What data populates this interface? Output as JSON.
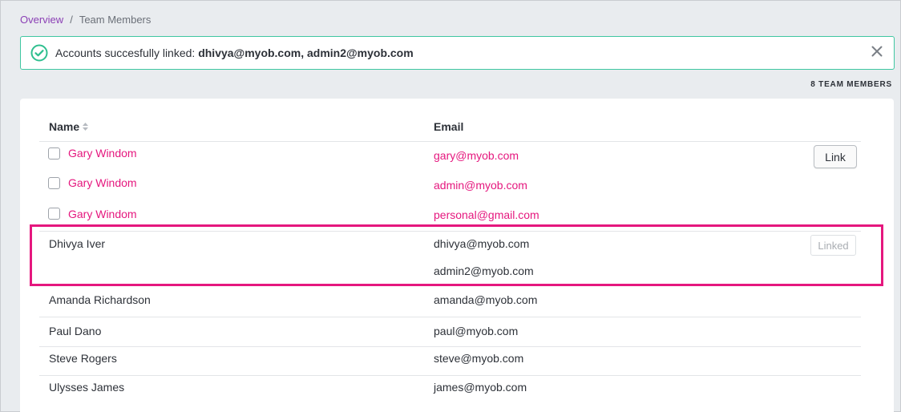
{
  "breadcrumb": {
    "parent": "Overview",
    "separator": "/",
    "current": "Team Members"
  },
  "alert": {
    "message": "Accounts succesfully linked:",
    "emails": "dhivya@myob.com, admin2@myob.com",
    "status_color": "#3fc7a1"
  },
  "member_count": "8 TEAM MEMBERS",
  "table": {
    "headers": {
      "name": "Name",
      "email": "Email"
    },
    "unlinked": [
      {
        "name": "Gary Windom",
        "email": "gary@myob.com"
      },
      {
        "name": "Gary Windom",
        "email": "admin@myob.com"
      },
      {
        "name": "Gary Windom",
        "email": "personal@gmail.com"
      }
    ],
    "link_button": "Link",
    "linked": {
      "name": "Dhivya Iver",
      "emails": [
        "dhivya@myob.com",
        "admin2@myob.com"
      ],
      "status_button": "Linked"
    },
    "members": [
      {
        "name": "Amanda Richardson",
        "email": "amanda@myob.com"
      },
      {
        "name": "Paul Dano",
        "email": "paul@myob.com"
      },
      {
        "name": "Steve Rogers",
        "email": "steve@myob.com"
      },
      {
        "name": "Ulysses James",
        "email": "james@myob.com"
      }
    ]
  },
  "colors": {
    "accent_pink": "#e5177e",
    "link_purple": "#8b3fb5",
    "success_green": "#3fc7a1"
  },
  "icons": {
    "alert": "check-circle-icon",
    "dismiss": "close-icon",
    "sort": "sort-icon"
  }
}
